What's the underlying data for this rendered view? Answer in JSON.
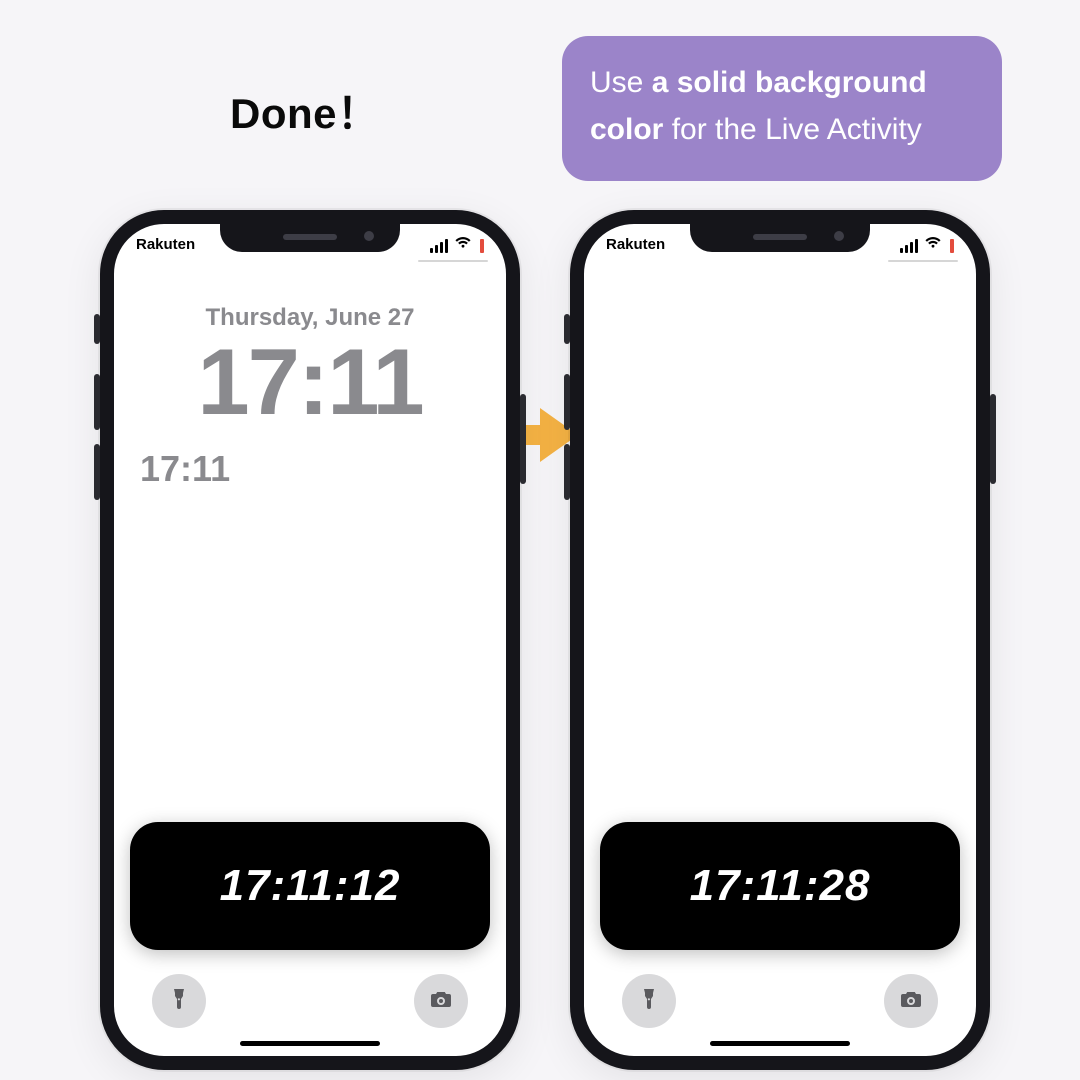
{
  "labels": {
    "done": "Done！",
    "tip_plain1": "Use ",
    "tip_bold": "a solid background color",
    "tip_plain2": " for the Live Activity"
  },
  "status": {
    "carrier": "Rakuten"
  },
  "lockscreen": {
    "date": "Thursday, June 27",
    "time": "17:11",
    "time_small": "17:11"
  },
  "live_activity": {
    "left_time": "17:11:12",
    "right_time": "17:11:28"
  },
  "colors": {
    "bubble": "#9b84c9",
    "arrow": "#f4b244",
    "card_bg": "#000000"
  }
}
